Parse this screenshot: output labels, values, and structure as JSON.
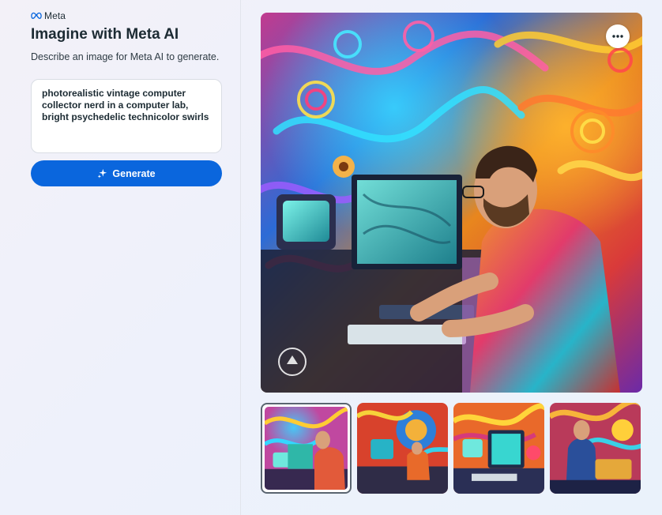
{
  "brand": {
    "name": "Meta",
    "logo_icon": "meta-infinity-icon"
  },
  "header": {
    "title": "Imagine with Meta AI",
    "subtitle": "Describe an image for Meta AI to generate."
  },
  "prompt": {
    "value": "photorealistic vintage computer collector nerd in a computer lab, bright psychedelic technicolor swirls"
  },
  "generate_button": {
    "label": "Generate",
    "icon": "sparkle-icon"
  },
  "main_image": {
    "alt": "photorealistic vintage computer collector nerd in a computer lab, bright psychedelic technicolor swirls",
    "more_icon": "more-horizontal-icon"
  },
  "thumbnails": [
    {
      "selected": true
    },
    {
      "selected": false
    },
    {
      "selected": false
    },
    {
      "selected": false
    }
  ],
  "colors": {
    "accent": "#0a66dd",
    "text": "#1c2b33",
    "background": "#eef1fb"
  }
}
